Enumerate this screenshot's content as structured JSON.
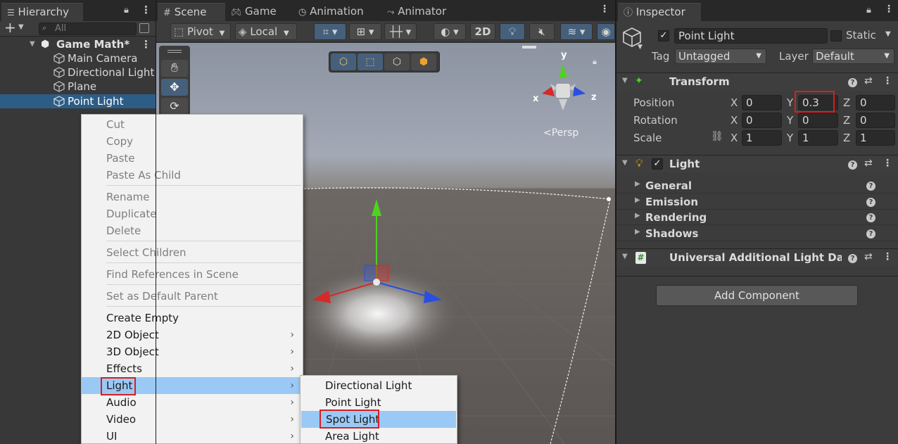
{
  "hierarchy": {
    "tab_label": "Hierarchy",
    "search_placeholder": "All",
    "scene_name": "Game Math*",
    "items": [
      {
        "label": "Main Camera"
      },
      {
        "label": "Directional Light"
      },
      {
        "label": "Plane"
      },
      {
        "label": "Point Light"
      }
    ]
  },
  "scene": {
    "tabs": [
      {
        "label": "Scene"
      },
      {
        "label": "Game"
      },
      {
        "label": "Animation"
      },
      {
        "label": "Animator"
      }
    ],
    "pivot_label": "Pivot",
    "local_label": "Local",
    "mode_2d": "2D",
    "persp_label": "Persp",
    "gizmo_axes": {
      "x": "x",
      "y": "y",
      "z": "z"
    }
  },
  "context_menu": {
    "items": [
      "Cut",
      "Copy",
      "Paste",
      "Paste As Child",
      "Rename",
      "Duplicate",
      "Delete",
      "Select Children",
      "Find References in Scene",
      "Set as Default Parent",
      "Create Empty",
      "2D Object",
      "3D Object",
      "Effects",
      "Light",
      "Audio",
      "Video",
      "UI"
    ],
    "highlighted": "Light"
  },
  "light_submenu": {
    "items": [
      "Directional Light",
      "Point Light",
      "Spot Light",
      "Area Light"
    ],
    "highlighted": "Spot Light"
  },
  "inspector": {
    "tab_label": "Inspector",
    "object_name": "Point Light",
    "static_label": "Static",
    "tag_label": "Tag",
    "tag_value": "Untagged",
    "layer_label": "Layer",
    "layer_value": "Default",
    "transform": {
      "title": "Transform",
      "position_label": "Position",
      "rotation_label": "Rotation",
      "scale_label": "Scale",
      "axis_x": "X",
      "axis_y": "Y",
      "axis_z": "Z",
      "position": {
        "x": "0",
        "y": "0.3",
        "z": "0"
      },
      "rotation": {
        "x": "0",
        "y": "0",
        "z": "0"
      },
      "scale": {
        "x": "1",
        "y": "1",
        "z": "1"
      }
    },
    "light": {
      "title": "Light",
      "sections": [
        "General",
        "Emission",
        "Rendering",
        "Shadows"
      ]
    },
    "additional_data_title": "Universal Additional Light Data (S",
    "add_component_label": "Add Component"
  },
  "colors": {
    "selection": "#2c5d87",
    "menu_highlight": "#9bc9f5",
    "red_highlight": "#d81e1e",
    "axis_x": "#d42a2a",
    "axis_y": "#4fd21f",
    "axis_z": "#2a4fe0"
  }
}
